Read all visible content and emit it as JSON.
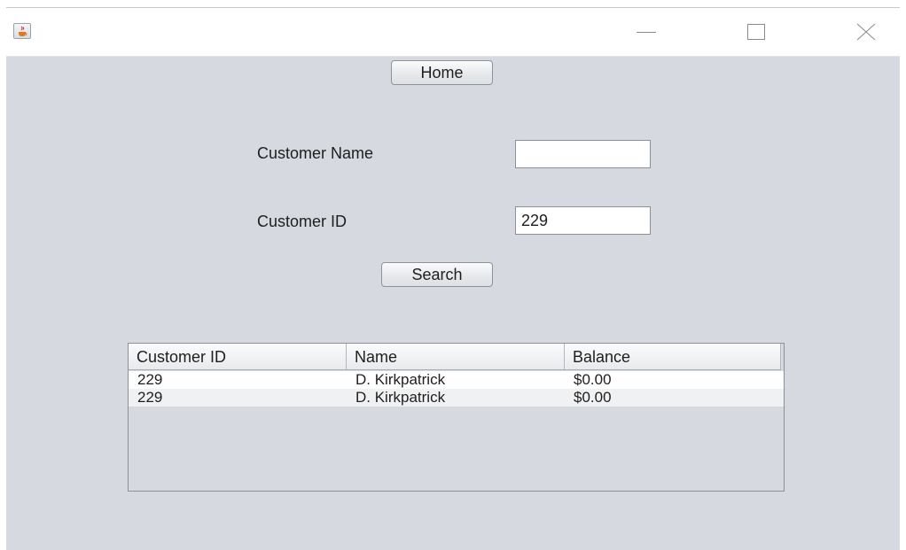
{
  "window": {
    "app_icon": "java-cup-icon",
    "controls": {
      "minimize_icon": "minimize-icon",
      "maximize_icon": "maximize-icon",
      "close_icon": "close-icon"
    }
  },
  "buttons": {
    "home_label": "Home",
    "search_label": "Search"
  },
  "form": {
    "customer_name_label": "Customer Name",
    "customer_name_value": "",
    "customer_id_label": "Customer ID",
    "customer_id_value": "229"
  },
  "table": {
    "columns": [
      "Customer ID",
      "Name",
      "Balance"
    ],
    "rows": [
      [
        "229",
        "D. Kirkpatrick",
        "$0.00"
      ],
      [
        "229",
        "D. Kirkpatrick",
        "$0.00"
      ]
    ]
  }
}
